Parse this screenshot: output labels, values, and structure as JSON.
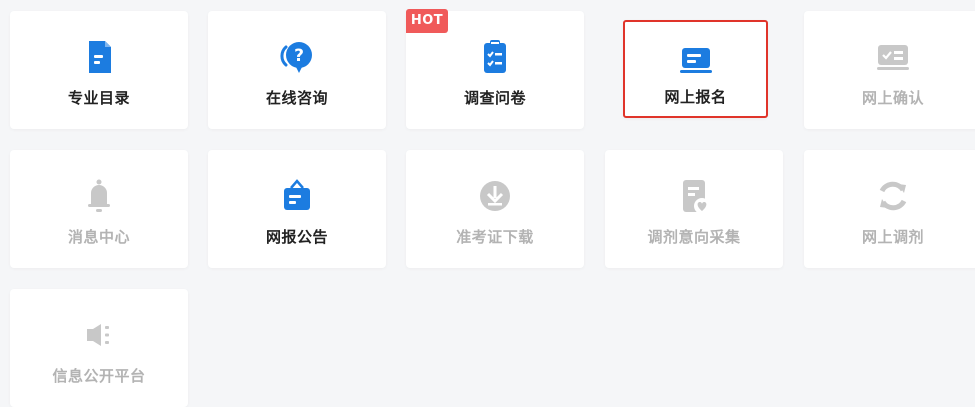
{
  "colors": {
    "accent": "#1c7ce0",
    "disabled_icon": "#c8c8c8",
    "disabled_text": "#b3b3b3",
    "active_text": "#222222",
    "hot_badge": "#f05a5a",
    "selected_border": "#e0342a"
  },
  "tiles": [
    {
      "label": "专业目录",
      "icon": "document-icon",
      "enabled": true
    },
    {
      "label": "在线咨询",
      "icon": "question-chat-icon",
      "enabled": true
    },
    {
      "label": "调查问卷",
      "icon": "clipboard-checklist-icon",
      "enabled": true,
      "badge": "HOT"
    },
    {
      "label": "网上报名",
      "icon": "laptop-form-icon",
      "enabled": true,
      "selected": true
    },
    {
      "label": "网上确认",
      "icon": "checkbox-card-icon",
      "enabled": false
    },
    {
      "label": "消息中心",
      "icon": "bell-icon",
      "enabled": false
    },
    {
      "label": "网报公告",
      "icon": "notice-board-icon",
      "enabled": true
    },
    {
      "label": "准考证下载",
      "icon": "download-circle-icon",
      "enabled": false
    },
    {
      "label": "调剂意向采集",
      "icon": "form-heart-icon",
      "enabled": false
    },
    {
      "label": "网上调剂",
      "icon": "refresh-icon",
      "enabled": false
    },
    {
      "label": "信息公开平台",
      "icon": "speaker-icon",
      "enabled": false
    }
  ]
}
